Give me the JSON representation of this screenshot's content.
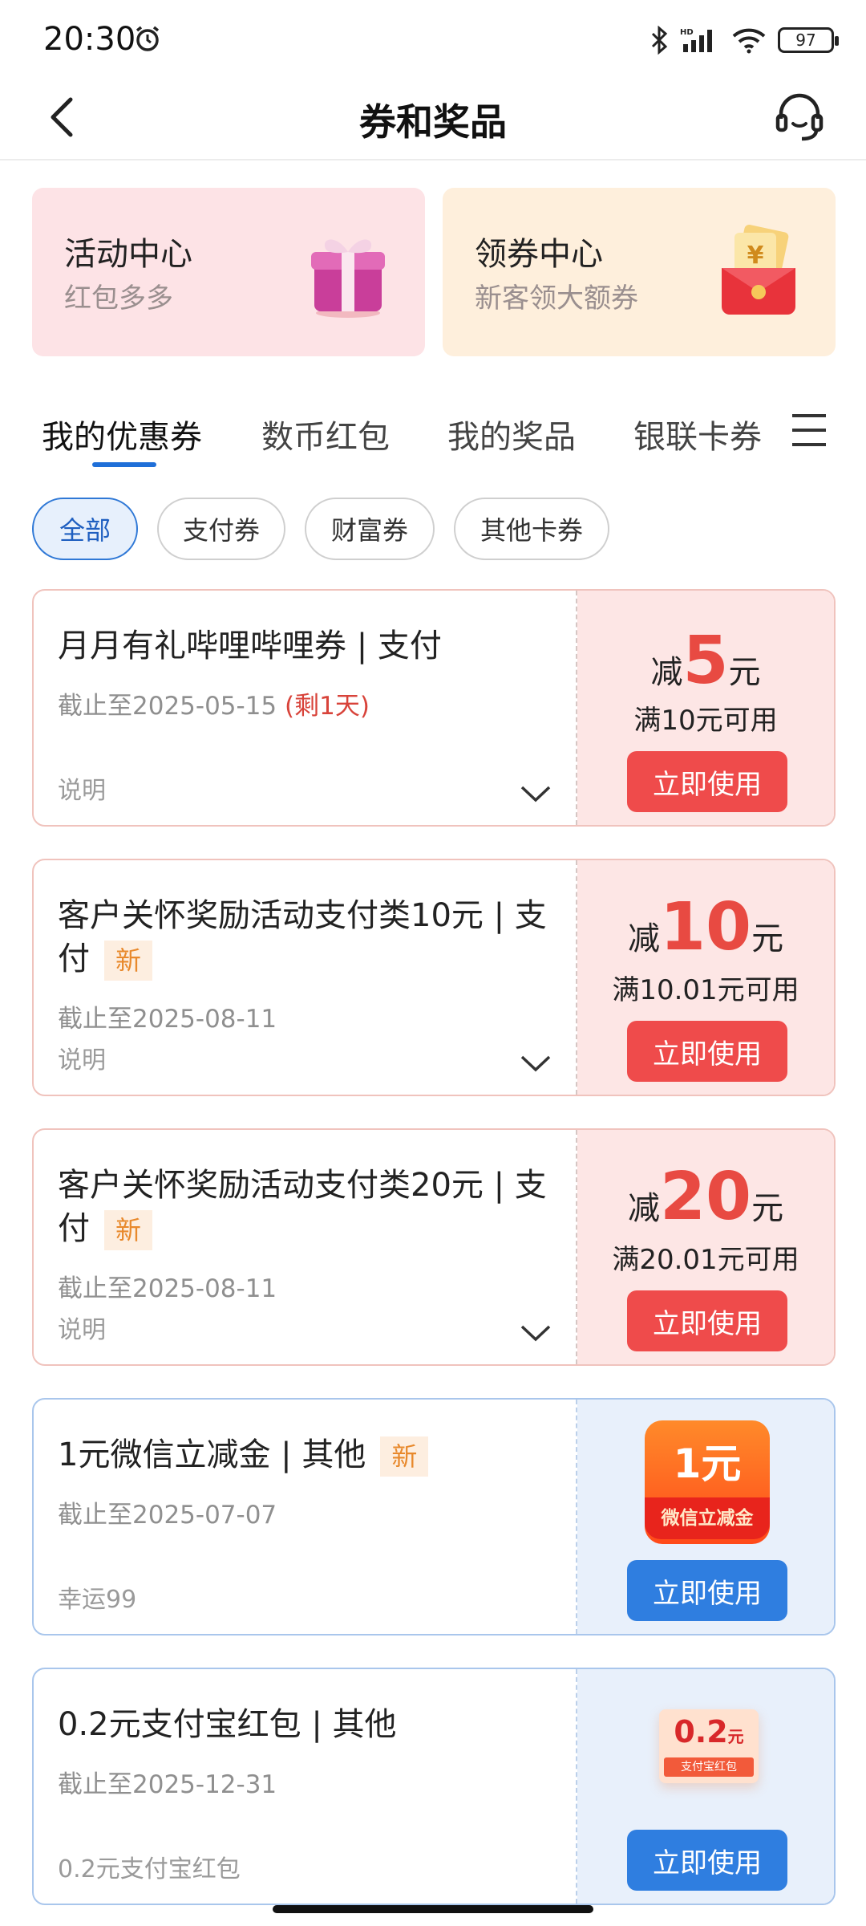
{
  "status_bar": {
    "time": "20:30",
    "battery": "97"
  },
  "nav": {
    "title": "券和奖品"
  },
  "entries": [
    {
      "title": "活动中心",
      "subtitle": "红包多多"
    },
    {
      "title": "领券中心",
      "subtitle": "新客领大额券"
    }
  ],
  "tabs": [
    "我的优惠券",
    "数币红包",
    "我的奖品",
    "银联卡券"
  ],
  "filters": [
    "全部",
    "支付券",
    "财富券",
    "其他卡券"
  ],
  "coupons": [
    {
      "title": "月月有礼哔哩哔哩券 | 支付",
      "date": "截止至2025-05-15",
      "remain": "(剩1天)",
      "note": "说明",
      "prefix": "减",
      "amount": "5",
      "unit": "元",
      "condition": "满10元可用",
      "button": "立即使用"
    },
    {
      "title": "客户关怀奖励活动支付类10元 | 支付",
      "badge": "新",
      "date": "截止至2025-08-11",
      "note": "说明",
      "prefix": "减",
      "amount": "10",
      "unit": "元",
      "condition": "满10.01元可用",
      "button": "立即使用"
    },
    {
      "title": "客户关怀奖励活动支付类20元 | 支付",
      "badge": "新",
      "date": "截止至2025-08-11",
      "note": "说明",
      "prefix": "减",
      "amount": "20",
      "unit": "元",
      "condition": "满20.01元可用",
      "button": "立即使用"
    },
    {
      "title": "1元微信立减金 | 其他",
      "badge": "新",
      "date": "截止至2025-07-07",
      "note": "幸运99",
      "card_amount": "1元",
      "card_label": "微信立减金",
      "button": "立即使用"
    },
    {
      "title": "0.2元支付宝红包 | 其他",
      "date": "截止至2025-12-31",
      "note": "0.2元支付宝红包",
      "card_amount": "0.2",
      "card_unit": "元",
      "card_label": "支付宝红包",
      "button": "立即使用"
    }
  ],
  "colors": {
    "accent_blue": "#1f6fd8",
    "coupon_red": "#e84a42",
    "button_red": "#ef4b4b",
    "button_blue": "#2f7ee0"
  },
  "icons": [
    "alarm-icon",
    "bluetooth-icon",
    "signal-icon",
    "wifi-icon",
    "battery-icon",
    "back-arrow-icon",
    "customer-service-icon",
    "gift-box-icon",
    "red-envelope-icon",
    "menu-icon",
    "chevron-down-icon"
  ]
}
